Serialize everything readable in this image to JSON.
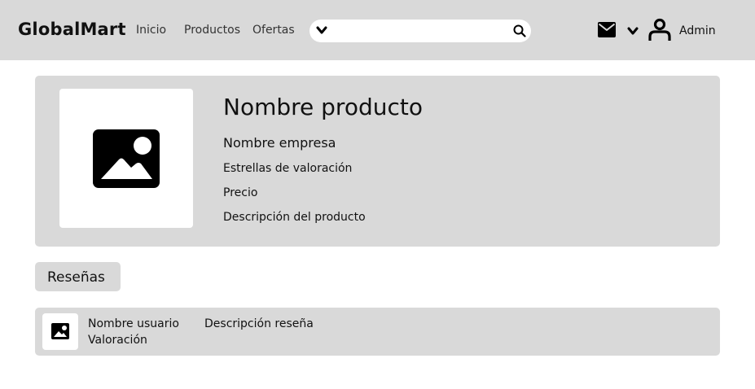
{
  "header": {
    "brand": "GlobalMart",
    "nav": [
      "Inicio",
      "Productos",
      "Ofertas"
    ],
    "search_placeholder": "",
    "user_name": "Admin"
  },
  "product": {
    "title": "Nombre producto",
    "company": "Nombre empresa",
    "rating": "Estrellas de valoración",
    "price": "Precio",
    "description": "Descripción del producto"
  },
  "reviews": {
    "tab_label": "Reseñas",
    "items": [
      {
        "user": "Nombre usuario",
        "rating": "Valoración",
        "text": "Descripción reseña"
      }
    ]
  },
  "icons": [
    "chevron-down-icon",
    "search-icon",
    "mail-icon",
    "user-icon",
    "image-icon"
  ],
  "colors": {
    "bar": "#d9d9d9",
    "card": "#d9d9d9",
    "white": "#ffffff",
    "ink": "#111111"
  }
}
